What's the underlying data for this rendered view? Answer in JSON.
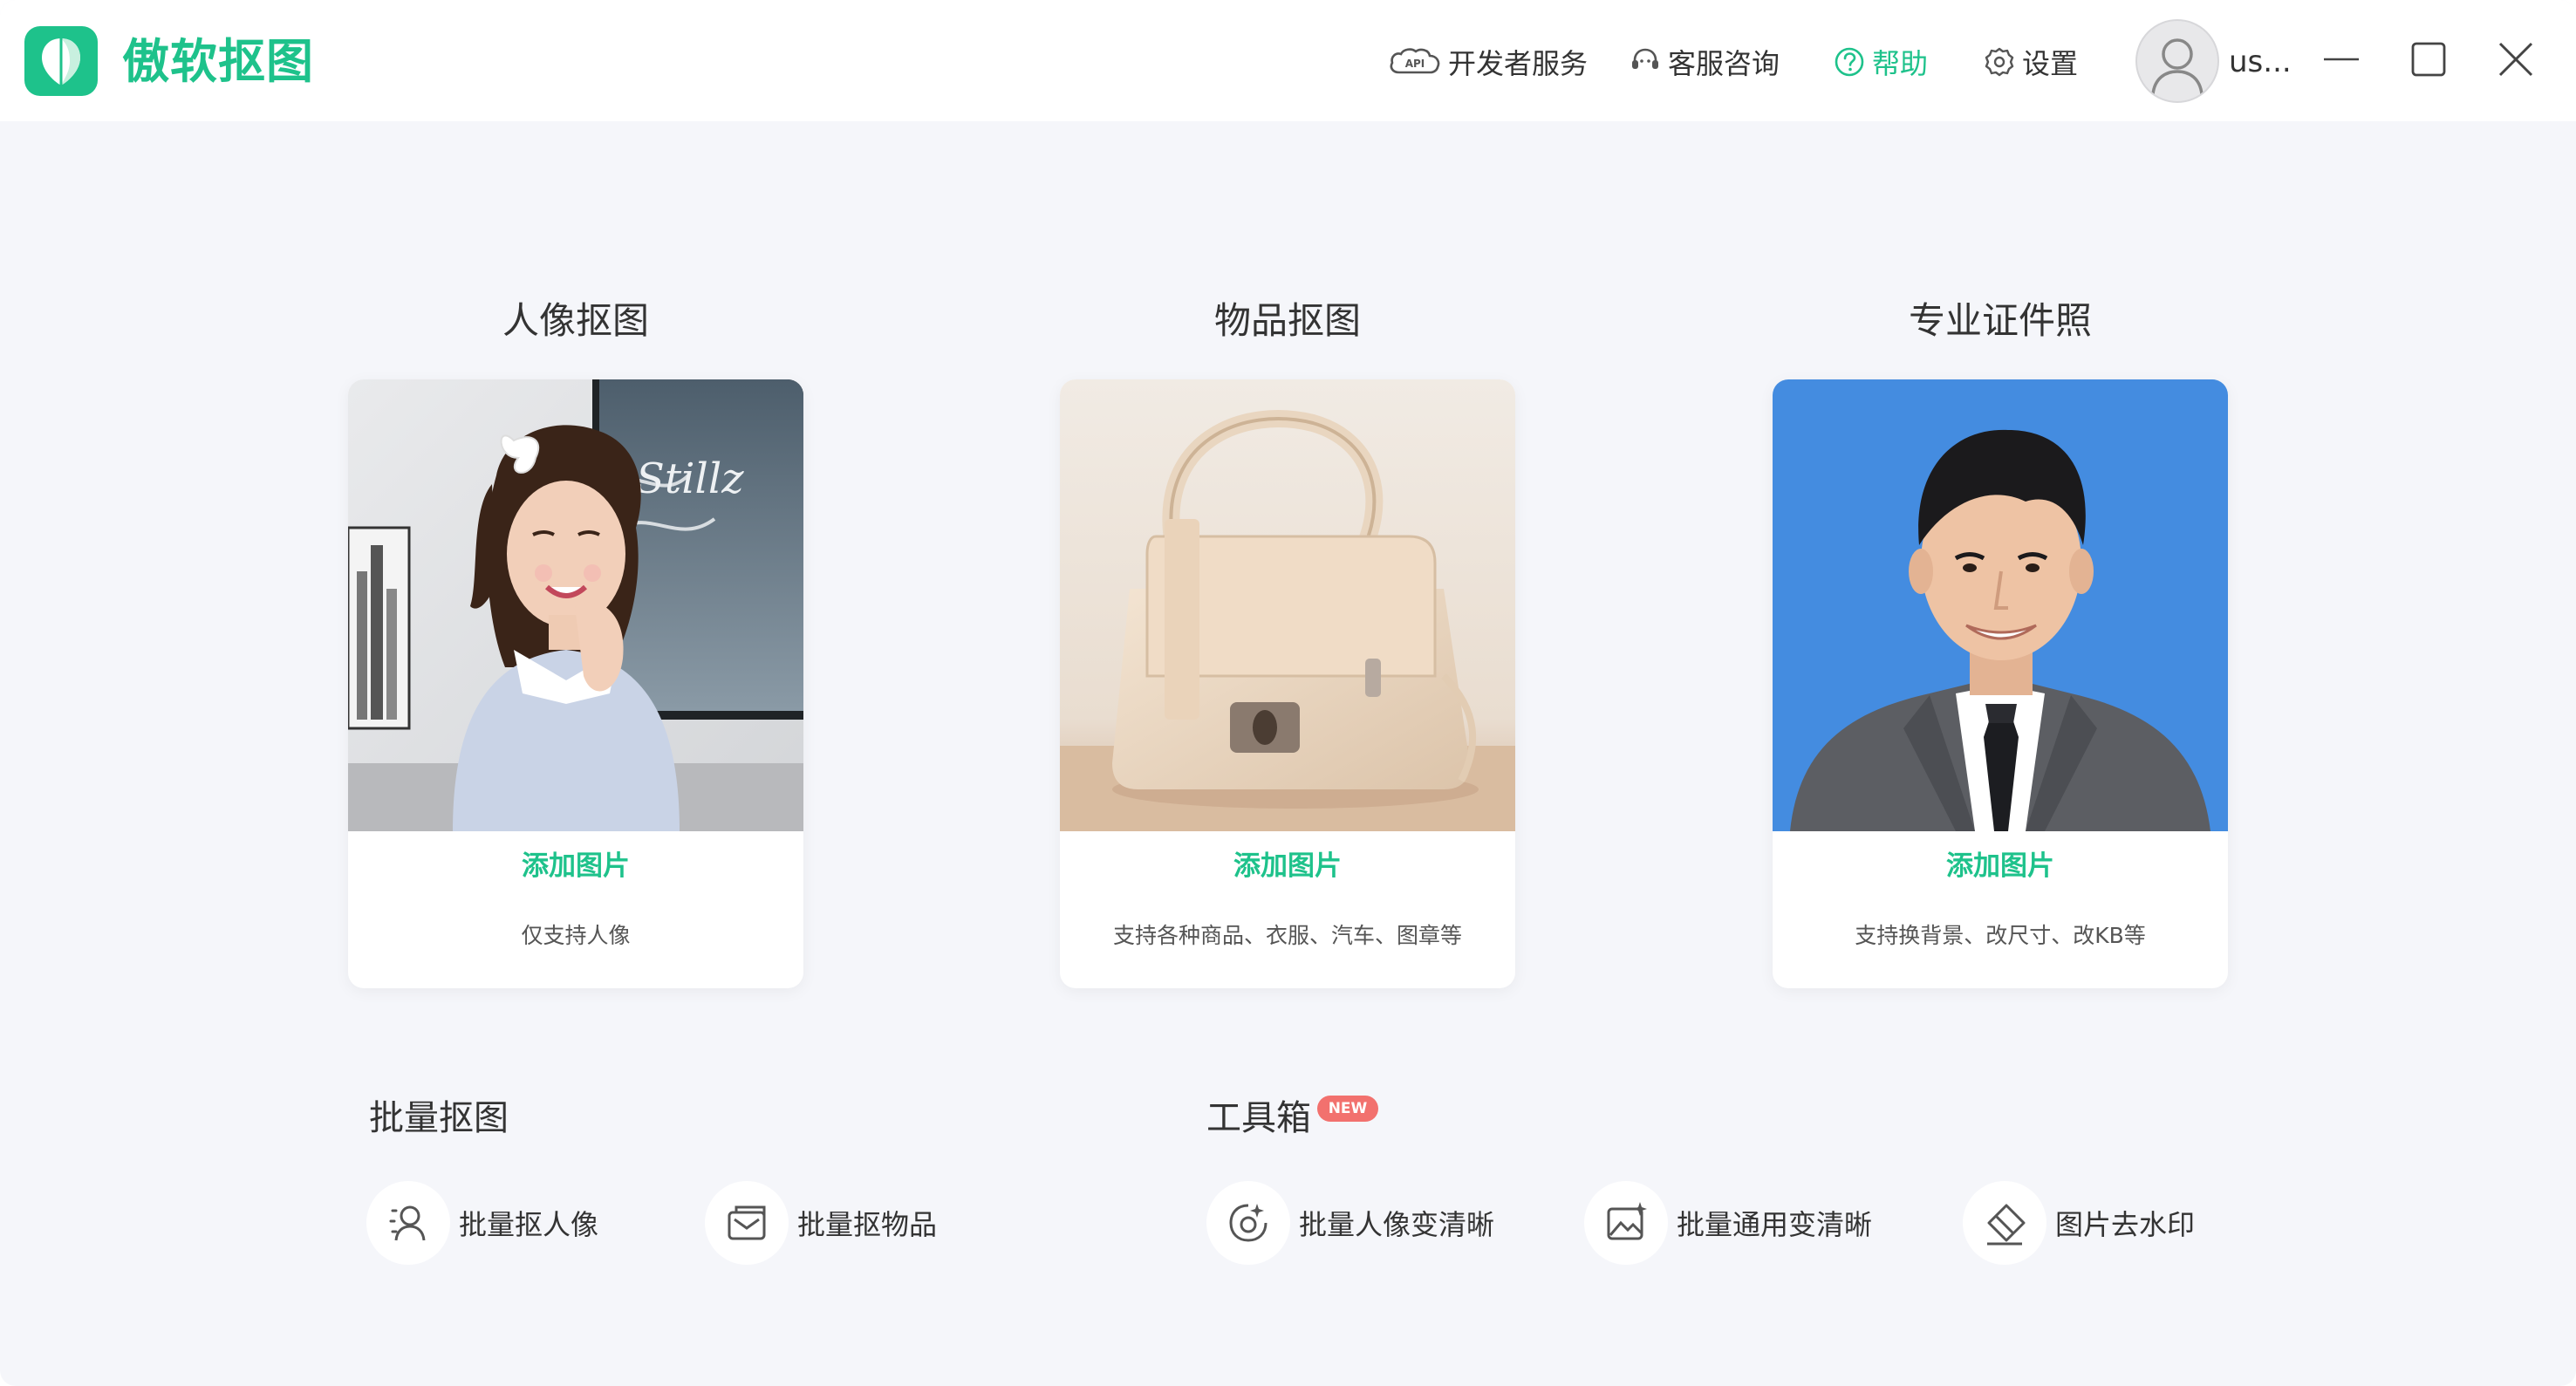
{
  "app": {
    "title": "傲软抠图",
    "accent_color": "#1ec28b"
  },
  "header": {
    "developer_label": "开发者服务",
    "developer_icon": "api-icon",
    "support_label": "客服咨询",
    "support_icon": "headset-icon",
    "help_label": "帮助",
    "help_icon": "question-circle-icon",
    "settings_label": "设置",
    "settings_icon": "gear-icon",
    "username": "us..."
  },
  "cards": [
    {
      "title": "人像抠图",
      "action": "添加图片",
      "description": "仅支持人像",
      "image": "portrait-woman-photo"
    },
    {
      "title": "物品抠图",
      "action": "添加图片",
      "description": "支持各种商品、衣服、汽车、图章等",
      "image": "handbag-photo"
    },
    {
      "title": "专业证件照",
      "action": "添加图片",
      "description": "支持换背景、改尺寸、改KB等",
      "image": "id-photo-man"
    }
  ],
  "batch": {
    "title": "批量抠图",
    "items": [
      {
        "label": "批量抠人像",
        "icon": "batch-portrait-icon"
      },
      {
        "label": "批量抠物品",
        "icon": "batch-object-icon"
      }
    ]
  },
  "toolbox": {
    "title": "工具箱",
    "badge": "NEW",
    "badge_color": "#f2716e",
    "items": [
      {
        "label": "批量人像变清晰",
        "icon": "portrait-enhance-icon"
      },
      {
        "label": "批量通用变清晰",
        "icon": "image-enhance-icon"
      },
      {
        "label": "图片去水印",
        "icon": "eraser-icon"
      }
    ]
  }
}
